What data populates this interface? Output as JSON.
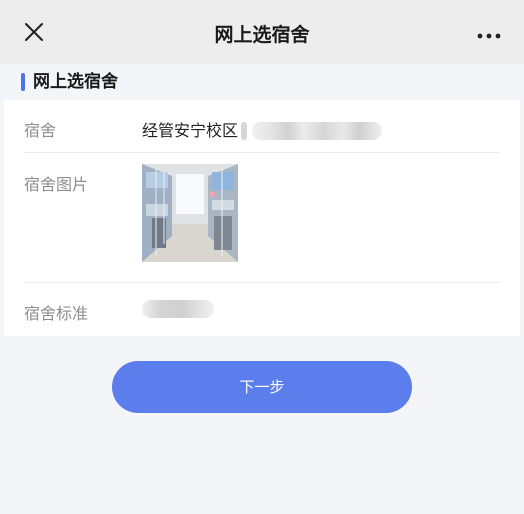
{
  "header": {
    "title": "网上选宿舍",
    "close_icon": "close-icon",
    "more_icon": "more-icon"
  },
  "section": {
    "title": "网上选宿舍",
    "accent_color": "#4a73e8"
  },
  "fields": {
    "dorm_label": "宿舍",
    "dorm_value": "经管安宁校区",
    "photo_label": "宿舍图片",
    "standard_label": "宿舍标准"
  },
  "actions": {
    "next_label": "下一步",
    "button_color": "#5b7eec"
  }
}
